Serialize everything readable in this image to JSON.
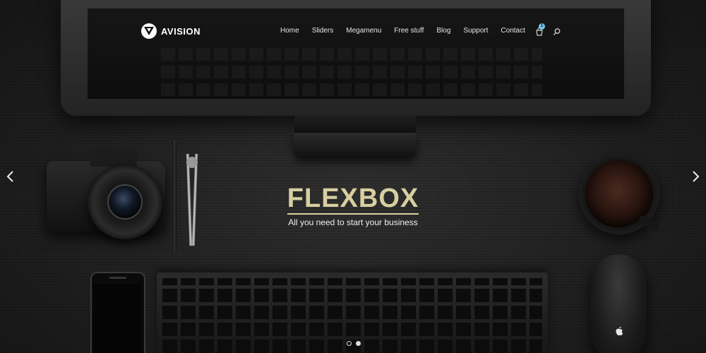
{
  "brand": {
    "name": "AVISION"
  },
  "nav": {
    "items": [
      {
        "label": "Home"
      },
      {
        "label": "Sliders"
      },
      {
        "label": "Megamenu"
      },
      {
        "label": "Free stuff"
      },
      {
        "label": "Blog"
      },
      {
        "label": "Support"
      },
      {
        "label": "Contact"
      }
    ],
    "cart_count": "1",
    "icons": {
      "cart": "cart-icon",
      "search": "search-icon"
    }
  },
  "hero": {
    "title": "FLEXBOX",
    "subtitle": "All you need to start your business"
  },
  "slider": {
    "prev_icon": "chevron-left-icon",
    "next_icon": "chevron-right-icon",
    "slide_count": 2,
    "active_slide": 2
  },
  "colors": {
    "title_accent": "#d8cfa0",
    "badge": "#6ec6e6",
    "background": "#1b1b1b"
  }
}
